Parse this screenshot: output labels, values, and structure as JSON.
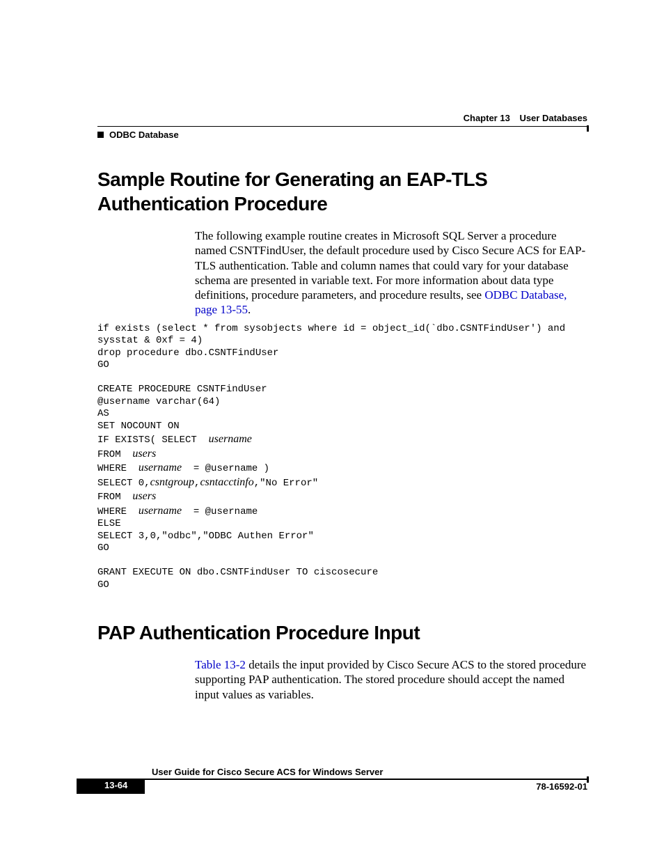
{
  "header": {
    "chapter_label": "Chapter 13",
    "chapter_title": "User Databases",
    "section": "ODBC Database"
  },
  "section1": {
    "title": "Sample Routine for Generating an EAP-TLS Authentication Procedure",
    "para_pre": " The following example routine creates in Microsoft SQL Server a procedure named CSNTFindUser, the default procedure used by Cisco Secure ACS for EAP-TLS authentication. Table and column names that could vary for your database schema are presented in variable text. For more information about data type definitions, procedure parameters, and procedure results, see ",
    "para_link": "ODBC Database, page 13-55",
    "para_post": ".",
    "code": {
      "l1": "if exists (select * from sysobjects where id = object_id(`dbo.CSNTFindUser') and sysstat & 0xf = 4)",
      "l2": "drop procedure dbo.CSNTFindUser",
      "l3": "GO",
      "l4": "",
      "l5": "CREATE PROCEDURE CSNTFindUser",
      "l6": "@username varchar(64)",
      "l7": "AS",
      "l8": "SET NOCOUNT ON",
      "l9a": "IF EXISTS( SELECT ",
      "l9v": "username",
      "l10a": "FROM ",
      "l10v": "users",
      "l11a": "WHERE ",
      "l11v": "username",
      "l11b": " = @username )",
      "l12a": "SELECT 0,",
      "l12v1": "csntgroup",
      "l12c": ",",
      "l12v2": "csntacctinfo",
      "l12b": ",\"No Error\"",
      "l13a": "FROM ",
      "l13v": "users",
      "l14a": "WHERE ",
      "l14v": "username",
      "l14b": " = @username",
      "l15": "ELSE",
      "l16": "SELECT 3,0,\"odbc\",\"ODBC Authen Error\"",
      "l17": "GO",
      "l18": "",
      "l19": "GRANT EXECUTE ON dbo.CSNTFindUser TO ciscosecure",
      "l20": "GO"
    }
  },
  "section2": {
    "title": "PAP Authentication Procedure Input",
    "link": "Table 13-2",
    "para_post": " details the input provided by Cisco Secure ACS to the stored procedure supporting PAP authentication. The stored procedure should accept the named input values as variables."
  },
  "footer": {
    "guide": "User Guide for Cisco Secure ACS for Windows Server",
    "page": "13-64",
    "docid": "78-16592-01"
  }
}
